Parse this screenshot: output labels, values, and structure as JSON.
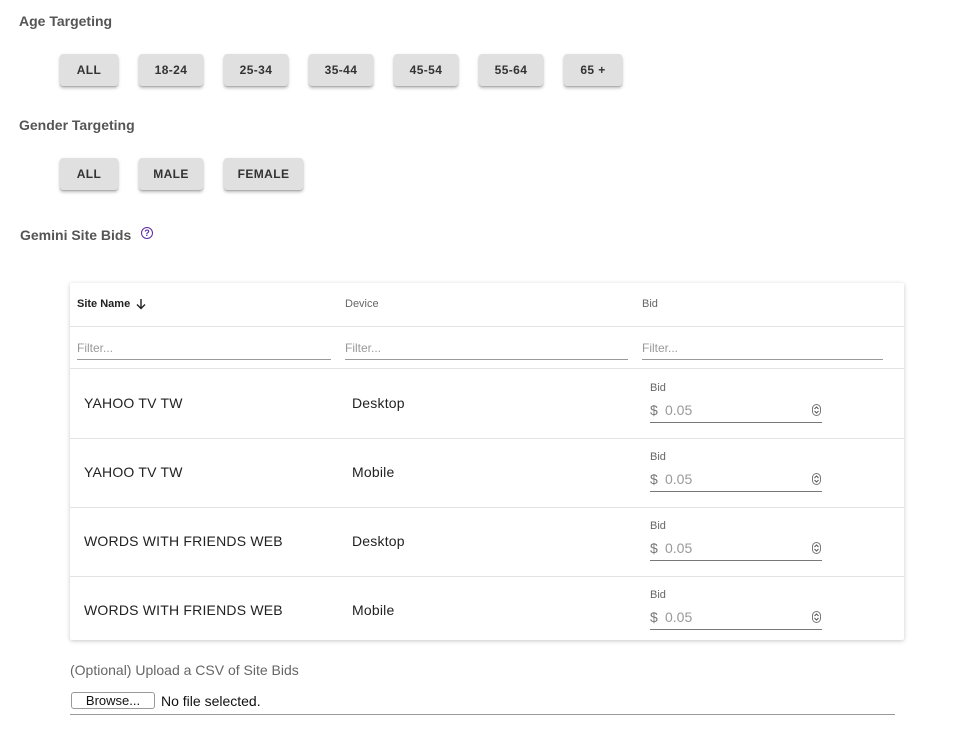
{
  "age_targeting": {
    "title": "Age Targeting",
    "options": [
      "ALL",
      "18-24",
      "25-34",
      "35-44",
      "45-54",
      "55-64",
      "65 +"
    ]
  },
  "gender_targeting": {
    "title": "Gender Targeting",
    "options": [
      "ALL",
      "MALE",
      "FEMALE"
    ]
  },
  "site_bids": {
    "title": "Gemini Site Bids",
    "help_icon": "help-circle-icon",
    "columns": {
      "site_name": "Site Name",
      "device": "Device",
      "bid": "Bid"
    },
    "filter_placeholder": "Filter...",
    "bid_field_label": "Bid",
    "currency": "$",
    "rows": [
      {
        "site": "YAHOO TV TW",
        "device": "Desktop",
        "bid": "0.05"
      },
      {
        "site": "YAHOO TV TW",
        "device": "Mobile",
        "bid": "0.05"
      },
      {
        "site": "WORDS WITH FRIENDS WEB",
        "device": "Desktop",
        "bid": "0.05"
      },
      {
        "site": "WORDS WITH FRIENDS WEB",
        "device": "Mobile",
        "bid": "0.05"
      }
    ]
  },
  "upload": {
    "label": "(Optional) Upload a CSV of Site Bids",
    "browse_label": "Browse...",
    "file_status": "No file selected."
  },
  "colors": {
    "chip_bg": "#e0e0e0",
    "help_icon": "#5b2ba0"
  }
}
